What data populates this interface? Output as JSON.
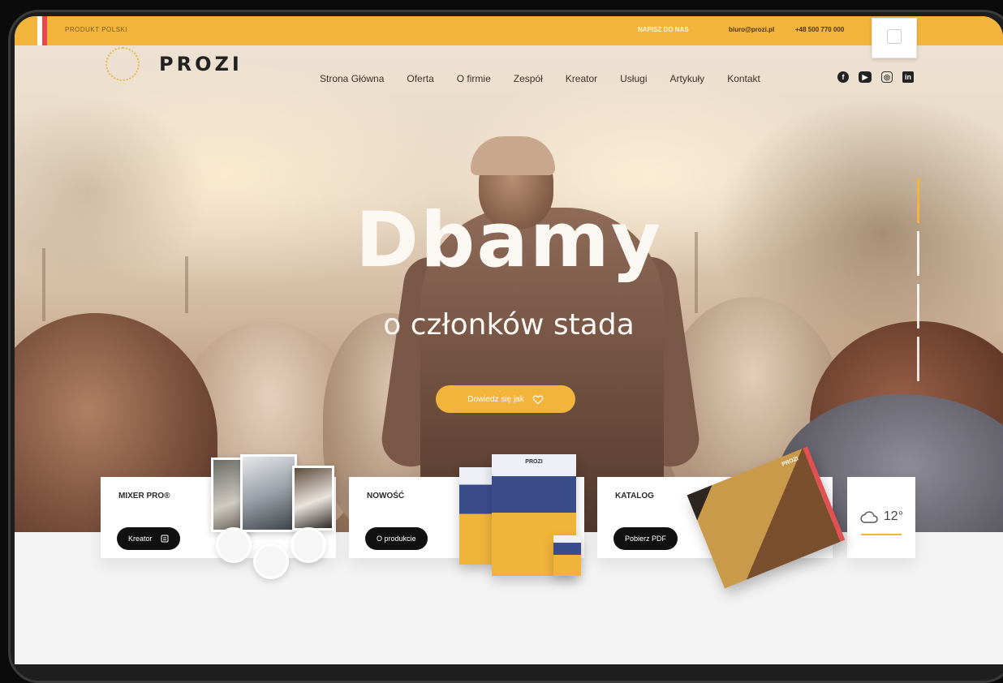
{
  "topbar": {
    "made_in": "PRODUKT POLSKI",
    "contact_label": "NAPISZ DO NAS",
    "email": "biuro@prozi.pl",
    "phone": "+48 500 770 000"
  },
  "header": {
    "logo": "PROZI",
    "nav": [
      "Strona Główna",
      "Oferta",
      "O firmie",
      "Zespół",
      "Kreator",
      "Usługi",
      "Artykuły",
      "Kontakt"
    ]
  },
  "social": {
    "facebook": "f",
    "youtube": "▶",
    "instagram": "◎",
    "linkedin": "in"
  },
  "hero": {
    "headline": "Dbamy",
    "subheadline": "o członków stada",
    "cta": "Dowiedz się jak"
  },
  "cards": {
    "mixer": {
      "title": "MIXER PRO®",
      "button": "Kreator"
    },
    "news": {
      "title": "NOWOŚĆ",
      "button": "O produkcie"
    },
    "catalog": {
      "title": "KATALOG",
      "button": "Pobierz PDF"
    },
    "weather": {
      "temperature": "12°"
    }
  },
  "products": {
    "pack_logo": "PROZI",
    "catalog_logo": "PROZI"
  },
  "colors": {
    "accent": "#f2b43b",
    "dark": "#111111",
    "text": "#3d3326"
  },
  "icons": [
    "heart-icon",
    "facebook-icon",
    "youtube-icon",
    "instagram-icon",
    "linkedin-icon",
    "cloud-icon",
    "calculator-icon"
  ]
}
